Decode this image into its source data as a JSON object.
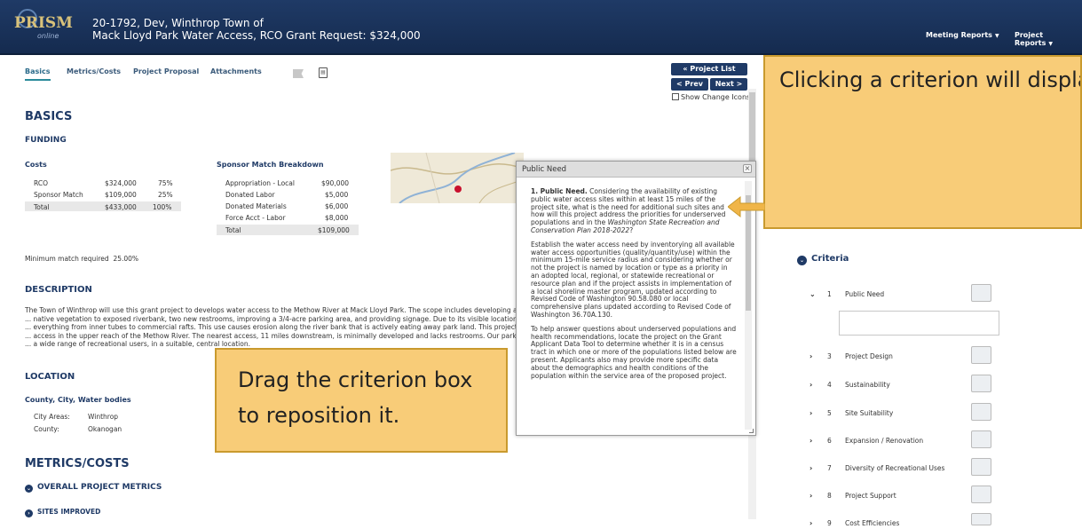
{
  "header": {
    "logo_text": "PRISM",
    "logo_sub": "online",
    "title_line1": "20-1792, Dev, Winthrop Town of",
    "title_line2": "Mack Lloyd Park Water Access, RCO Grant Request: $324,000",
    "menu": [
      "Meeting Reports",
      "Project Reports"
    ]
  },
  "tabs": [
    "Basics",
    "Metrics/Costs",
    "Project Proposal",
    "Attachments"
  ],
  "nav": {
    "project_list": "« Project List",
    "prev": "< Prev",
    "next": "Next >",
    "show_change_icons": "Show Change Icons"
  },
  "basics": {
    "title": "BASICS",
    "funding": "FUNDING",
    "costs_title": "Costs",
    "costs": [
      {
        "label": "RCO",
        "amount": "$324,000",
        "pct": "75%"
      },
      {
        "label": "Sponsor Match",
        "amount": "$109,000",
        "pct": "25%"
      },
      {
        "label": "Total",
        "amount": "$433,000",
        "pct": "100%"
      }
    ],
    "match_title": "Sponsor Match Breakdown",
    "match": [
      {
        "label": "Appropriation - Local",
        "amount": "$90,000"
      },
      {
        "label": "Donated Labor",
        "amount": "$5,000"
      },
      {
        "label": "Donated Materials",
        "amount": "$6,000"
      },
      {
        "label": "Force Acct - Labor",
        "amount": "$8,000"
      },
      {
        "label": "Total",
        "amount": "$109,000"
      }
    ],
    "min_match_label": "Minimum match required",
    "min_match_value": "25.00%"
  },
  "description": {
    "title": "DESCRIPTION",
    "text": "The Town of Winthrop will use this grant project to develops water access to the Methow River at Mack Lloyd Park. The scope includes developing a ... native vegetation to exposed riverbank, two new restrooms, improving a 3/4-acre parking area, and providing signage. Due to its visible location ... everything from inner tubes to commercial rafts. This use causes erosion along the river bank that is actively eating away park land. This project ... access in the upper reach of the Methow River. The nearest access, 11 miles downstream, is minimally developed and lacks restrooms. Our park ... a wide range of recreational users, in a suitable, central location."
  },
  "location": {
    "title": "LOCATION",
    "subtitle": "County, City, Water bodies",
    "city_label": "City Areas:",
    "city_value": "Winthrop",
    "county_label": "County:",
    "county_value": "Okanogan"
  },
  "metrics": {
    "title": "METRICS/COSTS",
    "overall": "OVERALL PROJECT METRICS",
    "sites": "SITES IMPROVED"
  },
  "popup": {
    "title": "Public Need",
    "close": "×",
    "para1_bold": "1. Public Need.",
    "para1": " Considering the availability of existing public water access sites within at least 15 miles of the project site, what is the need for additional such sites and how will this project address the priorities for underserved populations and in the ",
    "para1_italic": "Washington State Recreation and Conservation Plan 2018-2022",
    "para1_end": "?",
    "para2": "Establish the water access need by inventorying all available water access opportunities (quality/quantity/use) within the minimum 15-mile service radius and considering whether or not the project is named by location or type as a priority in an adopted local, regional, or statewide recreational or resource plan and if the project assists in implementation of a local shoreline master program, updated according to Revised Code of Washington 90.58.080 or local comprehensive plans updated according to Revised Code of Washington 36.70A.130.",
    "para3": "To help answer questions about underserved populations and health recommendations, locate the project on the Grant Applicant Data Tool to determine whether it is in a census tract in which one or more of the populations listed below are present. Applicants also may provide more specific data about the demographics and health conditions of the population within the service area of the proposed project."
  },
  "callouts": {
    "top": "Clicking a criterion will display the question’s full text, including specific items to consider.",
    "bottom": "Drag the criterion box to reposition it."
  },
  "criteria": {
    "title": "Criteria",
    "items": [
      {
        "chev": "⌄",
        "num": "1",
        "name": "Public Need"
      },
      {
        "chev": "›",
        "num": "3",
        "name": "Project Design"
      },
      {
        "chev": "›",
        "num": "4",
        "name": "Sustainability"
      },
      {
        "chev": "›",
        "num": "5",
        "name": "Site Suitability"
      },
      {
        "chev": "›",
        "num": "6",
        "name": "Expansion / Renovation"
      },
      {
        "chev": "›",
        "num": "7",
        "name": "Diversity of Recreational Uses"
      },
      {
        "chev": "›",
        "num": "8",
        "name": "Project Support"
      },
      {
        "chev": "›",
        "num": "9",
        "name": "Cost Efficiencies"
      }
    ]
  },
  "colors": {
    "header": "#1f3a66",
    "callout": "#f8cc78",
    "accent": "#2a8a9a"
  }
}
